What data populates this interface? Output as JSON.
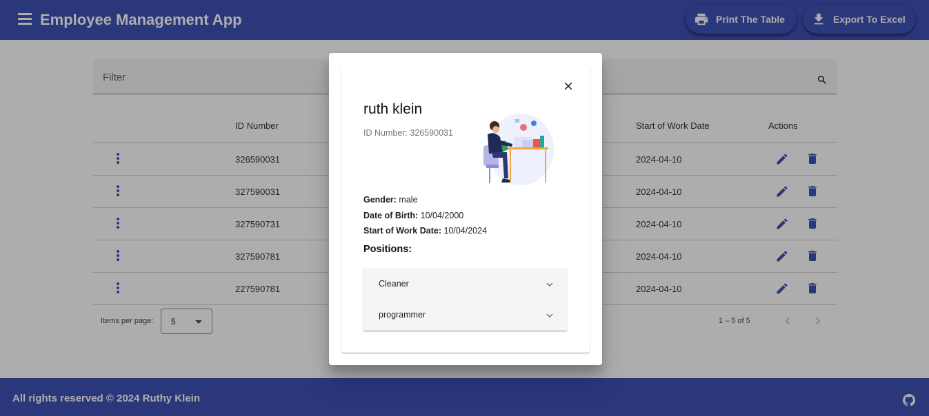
{
  "app": {
    "title": "Employee Management App"
  },
  "toolbar": {
    "print_label": "Print The Table",
    "export_label": "Export To Excel"
  },
  "filter": {
    "label": "Filter"
  },
  "table": {
    "headers": {
      "id": "ID Number",
      "start": "Start of Work Date",
      "actions": "Actions"
    },
    "rows": [
      {
        "id": "326590031",
        "start": "2024-04-10"
      },
      {
        "id": "327590031",
        "start": "2024-04-10"
      },
      {
        "id": "327590731",
        "start": "2024-04-10"
      },
      {
        "id": "327590781",
        "start": "2024-04-10"
      },
      {
        "id": "227590781",
        "start": "2024-04-10"
      }
    ]
  },
  "paginator": {
    "label": "Items per page:",
    "page_size": "5",
    "range": "1 – 5 of 5"
  },
  "footer": {
    "text": "All rights reserved © 2024 Ruthy Klein"
  },
  "dialog": {
    "name": "ruth klein",
    "id_text": "ID Number: 326590031",
    "gender_label": "Gender:",
    "gender": "male",
    "dob_label": "Date of Birth:",
    "dob": "10/04/2000",
    "start_label": "Start of Work Date:",
    "start": "10/04/2024",
    "positions_title": "Positions:",
    "positions": [
      {
        "label": "Cleaner"
      },
      {
        "label": "programmer"
      }
    ]
  },
  "colors": {
    "primary": "#3f51b5",
    "backdrop": "rgba(0,0,0,0.32)"
  }
}
